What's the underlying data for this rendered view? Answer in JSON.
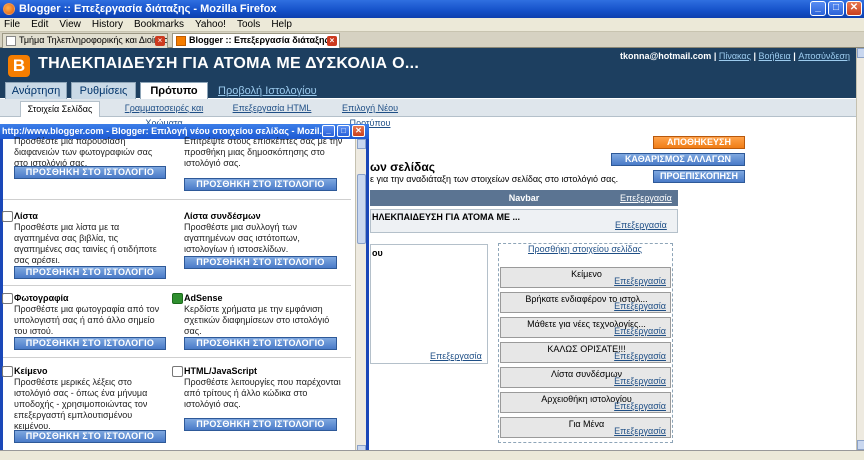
{
  "browser": {
    "title": "Blogger :: Επεξεργασία διάταξης - Mozilla Firefox",
    "menu": [
      "File",
      "Edit",
      "View",
      "History",
      "Bookmarks",
      "Yahoo!",
      "Tools",
      "Help"
    ],
    "tabs": [
      {
        "label": "Τμήμα Τηλεπληροφορικής και Διοίκησ..."
      },
      {
        "label": "Blogger :: Επεξεργασία διάταξης"
      }
    ],
    "window_buttons": {
      "minimize": "_",
      "maximize": "□",
      "close": "✕"
    }
  },
  "blogger": {
    "logo": "B",
    "blog_title": "ΤΗΛΕΚΠΑΙΔΕΥΣΗ ΓΙΑ ΑΤΟΜΑ ΜΕ ΔΥΣΚΟΛΙΑ Ο...",
    "user_email": "tkonna@hotmail.com",
    "user_links": [
      "Πίνακας",
      "Βοήθεια",
      "Αποσύνδεση"
    ],
    "main_tabs": [
      "Ανάρτηση",
      "Ρυθμίσεις",
      "Πρότυπο"
    ],
    "view_blog": "Προβολή Ιστολογίου",
    "sub_tabs": [
      "Στοιχεία Σελίδας",
      "Γραμματοσειρές και Χρώματα",
      "Επεξεργασία HTML",
      "Επιλογή Νέου Προτύπου"
    ],
    "buttons": {
      "save": "ΑΠΟΘΗΚΕΥΣΗ",
      "clear": "ΚΑΘΑΡΙΣΜΟΣ ΑΛΛΑΓΩΝ",
      "preview": "ΠΡΟΕΠΙΣΚΟΠΗΣΗ"
    },
    "layout": {
      "heading": "ων σελίδας",
      "description": "ε για την αναδιάταξη των στοιχείων σελίδας στο ιστολόγιό σας.",
      "navbar": "Navbar",
      "edit": "Επεξεργασία",
      "header_title": "ΗΛΕΚΠΑΙΔΕΥΣΗ ΓΙΑ ΑΤΟΜΑ ΜΕ ...",
      "posts_title": "ου",
      "add_element": "Προσθήκη στοιχείου σελίδας",
      "gadgets": [
        "Κείμενο",
        "Βρήκατε ενδιαφέρον το ιστολ...",
        "Μάθετε για νέες τεχνολογίες...",
        "ΚΑΛΩΣ ΟΡΙΣΑΤΕ!!!",
        "Λίστα συνδέσμων",
        "Αρχειοθήκη ιστολογίου",
        "Για Μένα"
      ]
    }
  },
  "popup": {
    "title": "http://www.blogger.com - Blogger: Επιλογή νέου στοιχείου σελίδας - Mozil...",
    "add_button": "ΠΡΟΣΘΗΚΗ ΣΤΟ ΙΣΤΟΛΟΓΙΟ",
    "items": [
      {
        "title": "",
        "desc": "Προσθέστε μια παρουσίαση διαφανειών των φωτογραφιών σας στο ιστολόγιό σας."
      },
      {
        "title": "",
        "desc": "Επιτρέψτε στους επισκέπτες σας με την προσθήκη μιας δημοσκόπησης στο ιστολόγιό σας."
      },
      {
        "title": "Λίστα",
        "desc": "Προσθέστε μια λίστα με τα αγαπημένα σας βιβλία, τις αγαπημένες σας ταινίες ή οτιδήποτε σας αρέσει."
      },
      {
        "title": "Λίστα συνδέσμων",
        "desc": "Προσθέστε μια συλλογή των αγαπημένων σας ιστότοπων, ιστολογίων ή ιστοσελίδων."
      },
      {
        "title": "Φωτογραφία",
        "desc": "Προσθέστε μια φωτογραφία από τον υπολογιστή σας ή από άλλο σημείο του ιστού."
      },
      {
        "title": "AdSense",
        "desc": "Κερδίστε χρήματα με την εμφάνιση σχετικών διαφημίσεων στο ιστολόγιό σας."
      },
      {
        "title": "Κείμενο",
        "desc": "Προσθέστε μερικές λέξεις στο ιστολόγιό σας - όπως ένα μήνυμα υποδοχής - χρησιμοποιώντας τον επεξεργαστή εμπλουτισμένου κειμένου."
      },
      {
        "title": "HTML/JavaScript",
        "desc": "Προσθέστε λειτουργίες που παρέχονται από τρίτους ή άλλο κώδικα στο ιστολόγιό σας."
      }
    ]
  }
}
